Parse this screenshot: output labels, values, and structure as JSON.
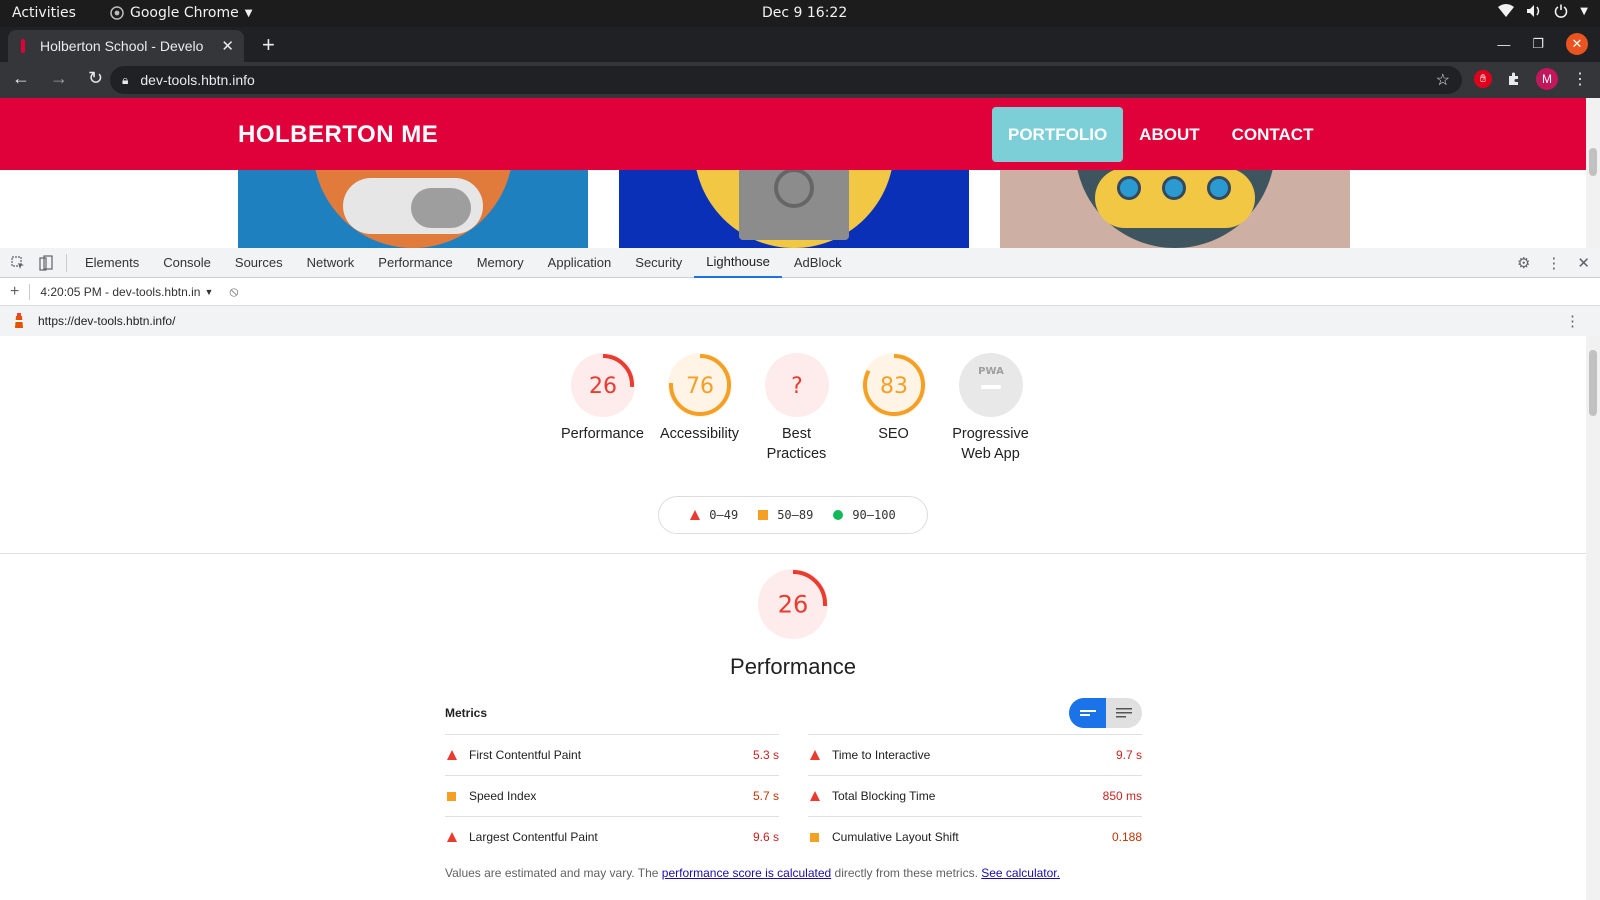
{
  "system_bar": {
    "activities": "Activities",
    "app": "Google Chrome",
    "clock": "Dec 9  16:22"
  },
  "browser": {
    "tab_title": "Holberton School - Develo",
    "url": "dev-tools.hbtn.info",
    "avatar_letter": "M"
  },
  "site": {
    "brand": "HOLBERTON ME",
    "nav": [
      "PORTFOLIO",
      "ABOUT",
      "CONTACT"
    ],
    "active_nav": "PORTFOLIO",
    "card_colors": [
      "#1f80c0",
      "#0a30b8",
      "#cdb0a3"
    ]
  },
  "devtools": {
    "tabs": [
      "Elements",
      "Console",
      "Sources",
      "Network",
      "Performance",
      "Memory",
      "Application",
      "Security",
      "Lighthouse",
      "AdBlock"
    ],
    "selected_tab": "Lighthouse",
    "report_selector": "4:20:05 PM - dev-tools.hbtn.in",
    "report_url": "https://dev-tools.hbtn.info/"
  },
  "lighthouse": {
    "gauges": [
      {
        "score": "26",
        "label": "Performance",
        "value": 0.26,
        "color": "#eb3a2e",
        "bg": "#fdeceb"
      },
      {
        "score": "76",
        "label": "Accessibility",
        "value": 0.76,
        "color": "#f4a024",
        "bg": "#fff4e5"
      },
      {
        "score": "?",
        "label": "Best Practices",
        "value": 0,
        "color": "#eb3a2e",
        "bg": "#fdeceb"
      },
      {
        "score": "83",
        "label": "SEO",
        "value": 0.83,
        "color": "#f4a024",
        "bg": "#fff4e5"
      },
      {
        "score": "PWA",
        "label": "Progressive Web App",
        "value": 0,
        "color": "#9e9e9e",
        "bg": "#e8e8e8"
      }
    ],
    "legend": [
      "0–49",
      "50–89",
      "90–100"
    ],
    "perf_section": {
      "score": "26",
      "value": 0.26,
      "title": "Performance"
    },
    "metrics_heading": "Metrics",
    "metrics_left": [
      {
        "name": "First Contentful Paint",
        "value": "5.3 s",
        "status": "fail"
      },
      {
        "name": "Speed Index",
        "value": "5.7 s",
        "status": "average"
      },
      {
        "name": "Largest Contentful Paint",
        "value": "9.6 s",
        "status": "fail"
      }
    ],
    "metrics_right": [
      {
        "name": "Time to Interactive",
        "value": "9.7 s",
        "status": "fail"
      },
      {
        "name": "Total Blocking Time",
        "value": "850 ms",
        "status": "fail"
      },
      {
        "name": "Cumulative Layout Shift",
        "value": "0.188",
        "status": "average"
      }
    ],
    "note": {
      "prefix": "Values are estimated and may vary. The ",
      "link1": "performance score is calculated",
      "middle": " directly from these metrics. ",
      "link2": "See calculator."
    }
  }
}
